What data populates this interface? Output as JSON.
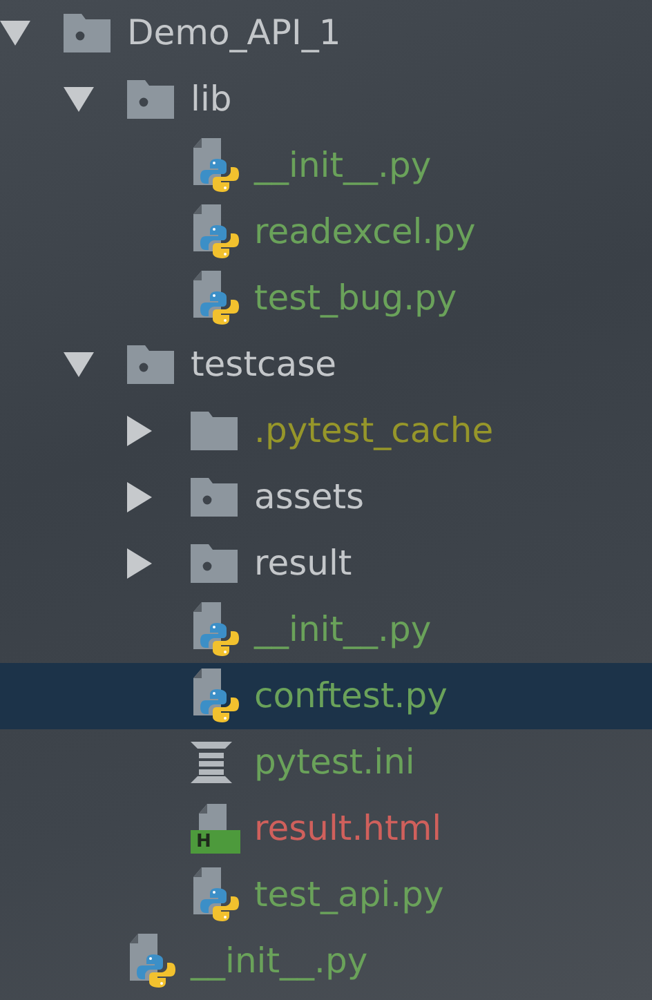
{
  "tree": [
    {
      "label": "Demo_API_1",
      "kind": "module-folder",
      "color": "#c4c7ca",
      "expanded": true,
      "selected": false,
      "children": [
        {
          "label": "lib",
          "kind": "module-folder",
          "color": "#c4c7ca",
          "expanded": true,
          "selected": false,
          "children": [
            {
              "label": "__init__.py",
              "kind": "python",
              "color": "#6aa25a",
              "selected": false
            },
            {
              "label": "readexcel.py",
              "kind": "python",
              "color": "#6aa25a",
              "selected": false
            },
            {
              "label": "test_bug.py",
              "kind": "python",
              "color": "#6aa25a",
              "selected": false
            }
          ]
        },
        {
          "label": "testcase",
          "kind": "module-folder",
          "color": "#c4c7ca",
          "expanded": true,
          "selected": false,
          "children": [
            {
              "label": ".pytest_cache",
              "kind": "folder",
              "color": "#96962a",
              "expanded": false,
              "selected": false
            },
            {
              "label": "assets",
              "kind": "module-folder",
              "color": "#c4c7ca",
              "expanded": false,
              "selected": false
            },
            {
              "label": "result",
              "kind": "module-folder",
              "color": "#c4c7ca",
              "expanded": false,
              "selected": false
            },
            {
              "label": "__init__.py",
              "kind": "python",
              "color": "#6aa25a",
              "selected": false
            },
            {
              "label": "conftest.py",
              "kind": "python",
              "color": "#6aa25a",
              "selected": true
            },
            {
              "label": "pytest.ini",
              "kind": "ini",
              "color": "#6aa25a",
              "selected": false
            },
            {
              "label": "result.html",
              "kind": "html",
              "color": "#d0605c",
              "selected": false,
              "badge": "H"
            },
            {
              "label": "test_api.py",
              "kind": "python",
              "color": "#6aa25a",
              "selected": false
            }
          ]
        },
        {
          "label": "__init__.py",
          "kind": "python",
          "color": "#6aa25a",
          "selected": false
        }
      ]
    }
  ]
}
